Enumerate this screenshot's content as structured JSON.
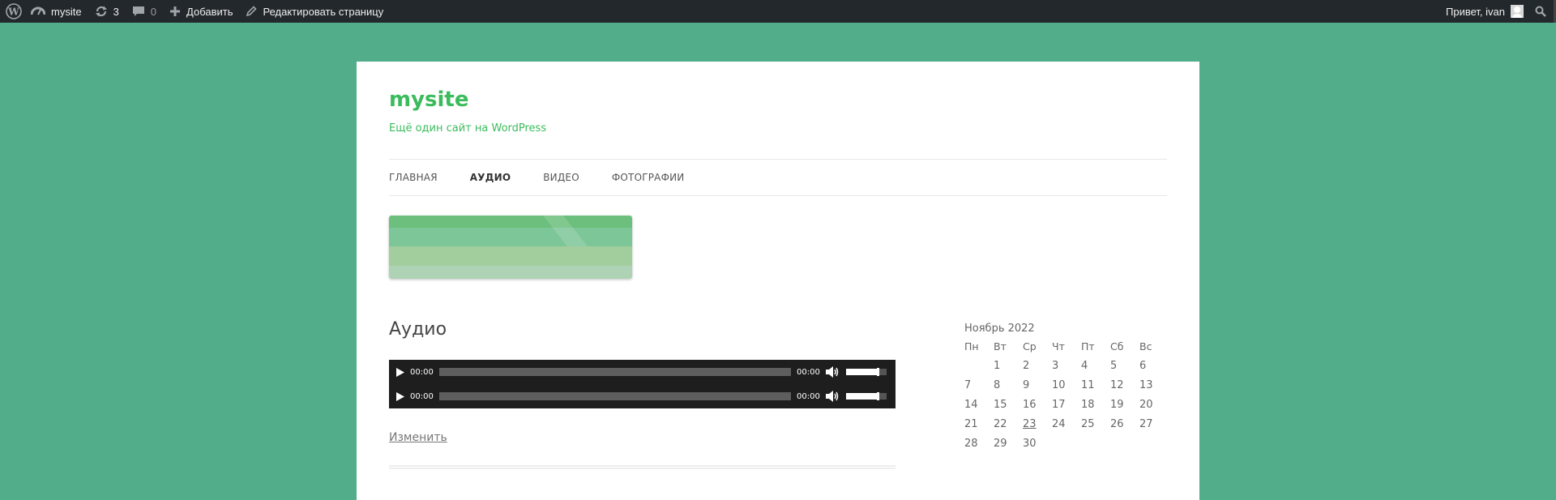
{
  "admin_bar": {
    "site_name": "mysite",
    "updates_count": "3",
    "comments_count": "0",
    "add_label": "Добавить",
    "edit_label": "Редактировать страницу",
    "greeting": "Привет, ivan"
  },
  "site": {
    "title": "mysite",
    "description": "Ещё один сайт на WordPress"
  },
  "nav": {
    "items": [
      {
        "label": "Главная"
      },
      {
        "label": "Аудио"
      },
      {
        "label": "Видео"
      },
      {
        "label": "Фотографии"
      }
    ],
    "current": "Аудио"
  },
  "post": {
    "title": "Аудио",
    "players": [
      {
        "current_time": "00:00",
        "duration": "00:00",
        "volume": 0.8
      },
      {
        "current_time": "00:00",
        "duration": "00:00",
        "volume": 0.8
      }
    ],
    "edit_link": "Изменить"
  },
  "calendar": {
    "caption": "Ноябрь 2022",
    "weekdays": [
      "Пн",
      "Вт",
      "Ср",
      "Чт",
      "Пт",
      "Сб",
      "Вс"
    ],
    "weeks": [
      [
        "",
        "1",
        "2",
        "3",
        "4",
        "5",
        "6"
      ],
      [
        "7",
        "8",
        "9",
        "10",
        "11",
        "12",
        "13"
      ],
      [
        "14",
        "15",
        "16",
        "17",
        "18",
        "19",
        "20"
      ],
      [
        "21",
        "22",
        "23",
        "24",
        "25",
        "26",
        "27"
      ],
      [
        "28",
        "29",
        "30",
        "",
        "",
        "",
        ""
      ]
    ],
    "linked_day": "23"
  },
  "colors": {
    "background": "#52ad8a",
    "accent": "#3bbc5c",
    "admin_bar": "#23282d"
  },
  "icons": [
    "wordpress-logo-icon",
    "dashboard-icon",
    "updates-icon",
    "comment-icon",
    "plus-icon",
    "pencil-icon",
    "search-icon",
    "play-icon",
    "volume-icon",
    "avatar-icon"
  ]
}
